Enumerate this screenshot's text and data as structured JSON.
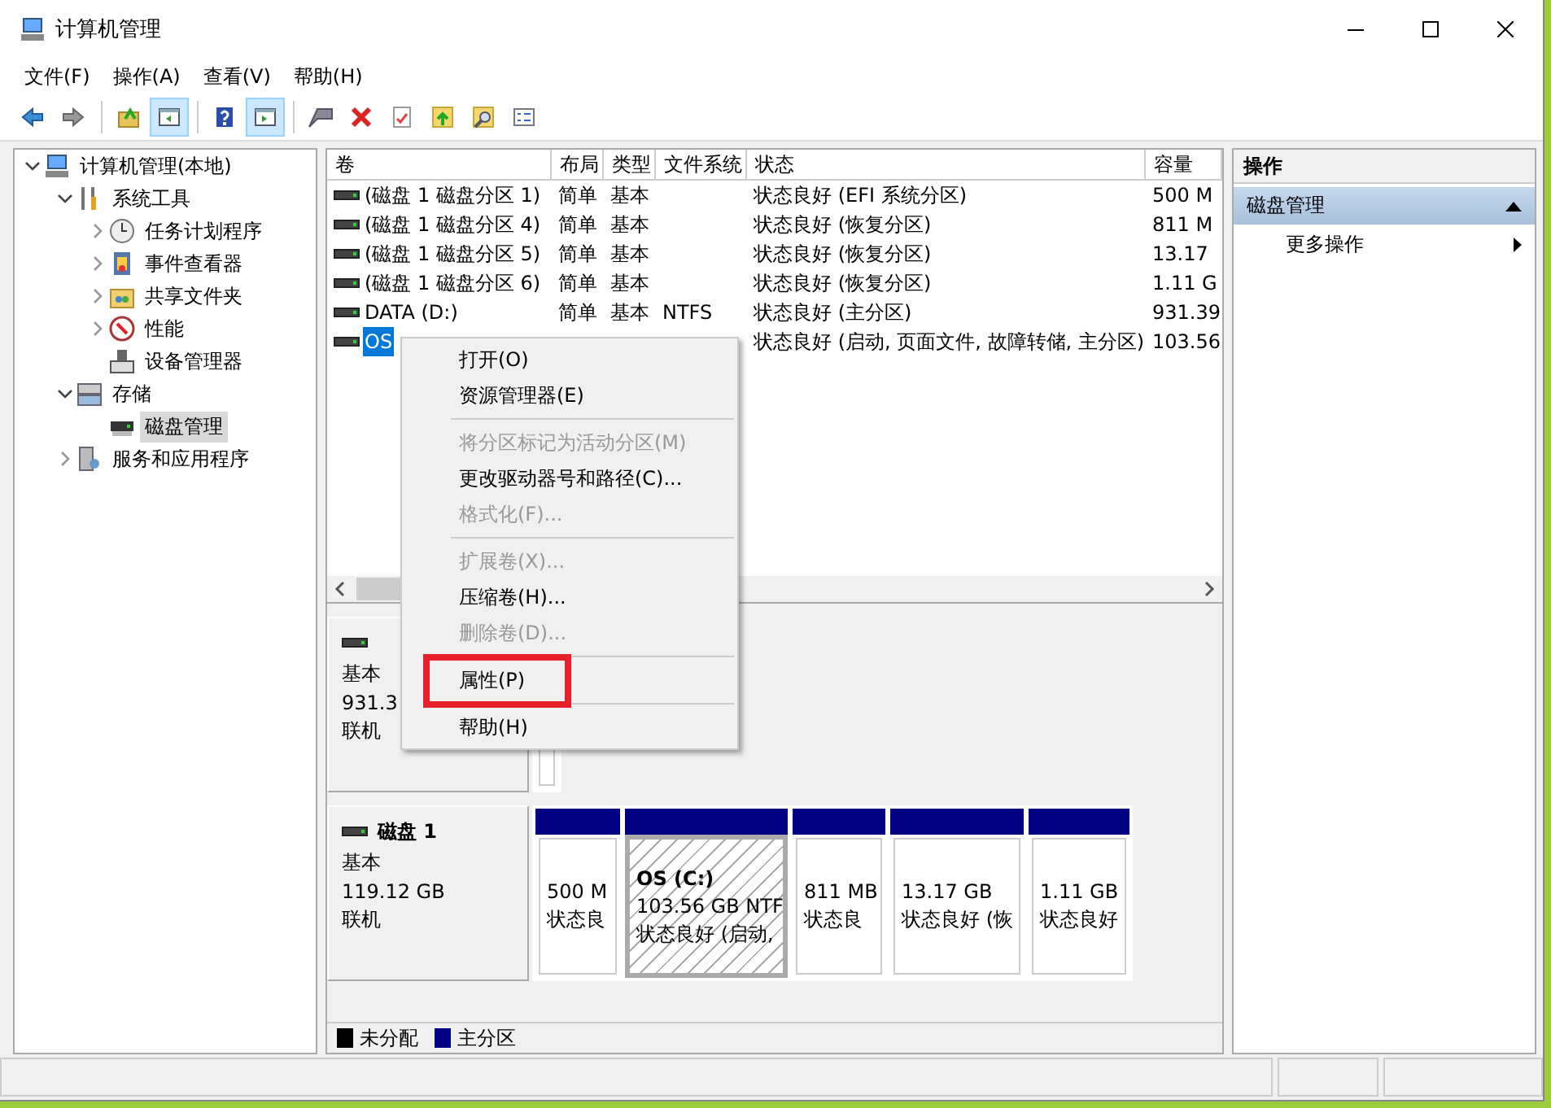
{
  "window": {
    "title": "计算机管理"
  },
  "menu": [
    "文件(F)",
    "操作(A)",
    "查看(V)",
    "帮助(H)"
  ],
  "toolbar": [
    {
      "pressed": false
    },
    {
      "pressed": false
    },
    {
      "pressed": false
    },
    {
      "pressed": true
    },
    {
      "pressed": false
    },
    {
      "pressed": true
    },
    {
      "pressed": false
    },
    {
      "pressed": false
    },
    {
      "pressed": false
    },
    {
      "pressed": false
    },
    {
      "pressed": false
    },
    {
      "pressed": false
    }
  ],
  "tree": [
    {
      "label": "计算机管理(本地)",
      "expanded": true,
      "selected": false,
      "children": [
        {
          "label": "系统工具",
          "expanded": true,
          "selected": false,
          "children": [
            {
              "label": "任务计划程序",
              "expanded": false,
              "selected": false
            },
            {
              "label": "事件查看器",
              "expanded": false,
              "selected": false
            },
            {
              "label": "共享文件夹",
              "expanded": false,
              "selected": false
            },
            {
              "label": "性能",
              "expanded": false,
              "selected": false
            },
            {
              "label": "设备管理器",
              "selected": false
            }
          ]
        },
        {
          "label": "存储",
          "expanded": true,
          "selected": false,
          "children": [
            {
              "label": "磁盘管理",
              "selected": true
            }
          ]
        },
        {
          "label": "服务和应用程序",
          "expanded": false,
          "selected": false
        }
      ]
    }
  ],
  "volume_table": {
    "columns": [
      "卷",
      "布局",
      "类型",
      "文件系统",
      "状态",
      "容量"
    ],
    "rows": [
      {
        "cells": [
          "(磁盘 1 磁盘分区 1)",
          "简单",
          "基本",
          "",
          "状态良好 (EFI 系统分区)",
          "500 M"
        ],
        "selected": false
      },
      {
        "cells": [
          "(磁盘 1 磁盘分区 4)",
          "简单",
          "基本",
          "",
          "状态良好 (恢复分区)",
          "811 M"
        ],
        "selected": false
      },
      {
        "cells": [
          "(磁盘 1 磁盘分区 5)",
          "简单",
          "基本",
          "",
          "状态良好 (恢复分区)",
          "13.17"
        ],
        "selected": false
      },
      {
        "cells": [
          "(磁盘 1 磁盘分区 6)",
          "简单",
          "基本",
          "",
          "状态良好 (恢复分区)",
          "1.11 G"
        ],
        "selected": false
      },
      {
        "cells": [
          "DATA (D:)",
          "简单",
          "基本",
          "NTFS",
          "状态良好 (主分区)",
          "931.39"
        ],
        "selected": false
      },
      {
        "cells": [
          "OS",
          "",
          "",
          "",
          "状态良好 (启动, 页面文件, 故障转储, 主分区)",
          "103.56"
        ],
        "selected": true
      }
    ]
  },
  "disks": [
    {
      "type": "基本",
      "capacity": "931.3",
      "status": "联机",
      "partitions": [
        {
          "selected": false
        }
      ]
    },
    {
      "name": "磁盘 1",
      "type": "基本",
      "capacity": "119.12 GB",
      "status": "联机",
      "partitions": [
        {
          "lines": [
            "500 M",
            "状态良"
          ],
          "selected": false
        },
        {
          "title": "OS  (C:)",
          "lines": [
            "103.56 GB NTF",
            "状态良好 (启动,"
          ],
          "selected": true
        },
        {
          "lines": [
            "811 MB",
            "状态良"
          ],
          "selected": false
        },
        {
          "lines": [
            "13.17 GB",
            "状态良好 (恢"
          ],
          "selected": false
        },
        {
          "lines": [
            "1.11 GB",
            "状态良好"
          ],
          "selected": false
        }
      ]
    }
  ],
  "legend": [
    {
      "label": "未分配",
      "color": "#000000"
    },
    {
      "label": "主分区",
      "color": "#000080"
    }
  ],
  "actions": {
    "header": "操作",
    "group": "磁盘管理",
    "expanded": true,
    "items": [
      "更多操作"
    ]
  },
  "context_menu": [
    {
      "kind": "item",
      "label": "打开(O)",
      "disabled": false,
      "annotated": false
    },
    {
      "kind": "item",
      "label": "资源管理器(E)",
      "disabled": false,
      "annotated": false
    },
    {
      "kind": "separator"
    },
    {
      "kind": "item",
      "label": "将分区标记为活动分区(M)",
      "disabled": true,
      "annotated": false
    },
    {
      "kind": "item",
      "label": "更改驱动器号和路径(C)...",
      "disabled": false,
      "annotated": false
    },
    {
      "kind": "item",
      "label": "格式化(F)...",
      "disabled": true,
      "annotated": false
    },
    {
      "kind": "separator"
    },
    {
      "kind": "item",
      "label": "扩展卷(X)...",
      "disabled": true,
      "annotated": false
    },
    {
      "kind": "item",
      "label": "压缩卷(H)...",
      "disabled": false,
      "annotated": false
    },
    {
      "kind": "item",
      "label": "删除卷(D)...",
      "disabled": true,
      "annotated": false
    },
    {
      "kind": "separator"
    },
    {
      "kind": "item",
      "label": "属性(P)",
      "disabled": false,
      "annotated": true
    },
    {
      "kind": "separator"
    },
    {
      "kind": "item",
      "label": "帮助(H)",
      "disabled": false,
      "annotated": false
    }
  ]
}
